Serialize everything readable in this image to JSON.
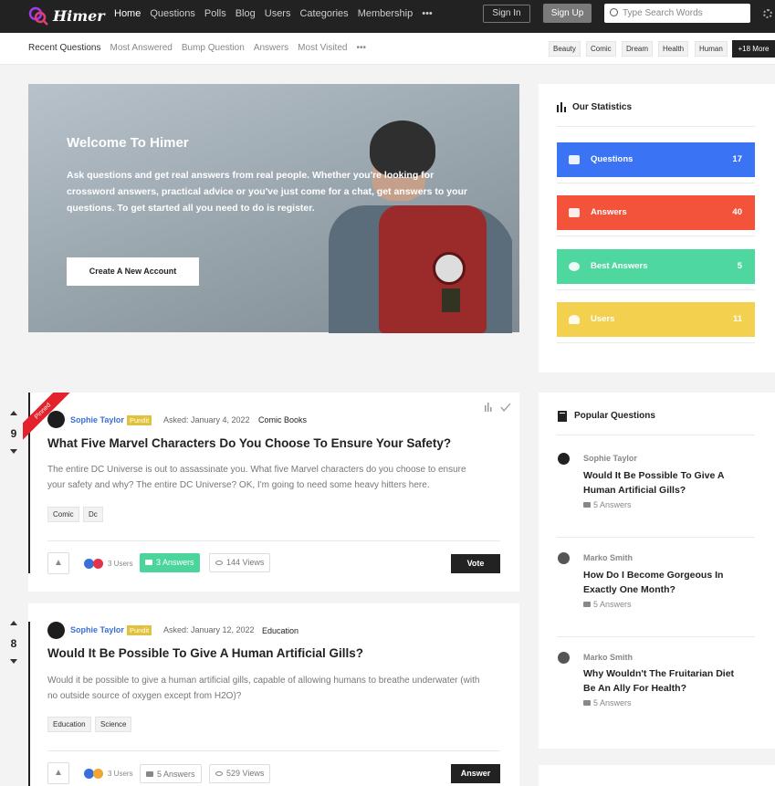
{
  "header": {
    "logo_text": "Himer",
    "nav": [
      "Home",
      "Questions",
      "Polls",
      "Blog",
      "Users",
      "Categories",
      "Membership"
    ],
    "nav_more": "•••",
    "signin": "Sign In",
    "signup": "Sign Up",
    "search_placeholder": "Type Search Words"
  },
  "subnav": {
    "items": [
      "Recent Questions",
      "Most Answered",
      "Bump Question",
      "Answers",
      "Most Visited"
    ],
    "more": "•••",
    "tags": [
      "Beauty",
      "Comic",
      "Dream",
      "Health",
      "Human"
    ],
    "tags_more": "+18 More"
  },
  "hero": {
    "title": "Welcome To Himer",
    "text": "Ask questions and get real answers from real people. Whether you're looking for crossword answers, practical advice or you've just come for a chat, get answers to your questions. To get started all you need to do is register.",
    "button": "Create A New Account"
  },
  "stats": {
    "title": "Our Statistics",
    "items": [
      {
        "label": "Questions",
        "value": "17",
        "color": "#3b73f5"
      },
      {
        "label": "Answers",
        "value": "40",
        "color": "#f2533a"
      },
      {
        "label": "Best Answers",
        "value": "5",
        "color": "#4ed89f"
      },
      {
        "label": "Users",
        "value": "11",
        "color": "#f3d04d"
      }
    ]
  },
  "popular": {
    "title": "Popular Questions",
    "items": [
      {
        "author": "Sophie Taylor",
        "title": "Would It Be Possible To Give A Human Artificial Gills?",
        "answers": "5 Answers"
      },
      {
        "author": "Marko Smith",
        "title": "How Do I Become Gorgeous In Exactly One Month?",
        "answers": "5 Answers"
      },
      {
        "author": "Marko Smith",
        "title": "Why Wouldn't The Fruitarian Diet Be An Ally For Health?",
        "answers": "5 Answers"
      }
    ]
  },
  "questions": [
    {
      "votes": "9",
      "pinned": "Pinned",
      "author": "Sophie Taylor",
      "badge": "Pundit",
      "date": "Asked: January 4, 2022",
      "category": "Comic Books",
      "title": "What Five Marvel Characters Do You Choose To Ensure Your Safety?",
      "excerpt": "The entire DC Universe is out to assassinate you. What five Marvel characters do you choose to ensure your safety and why? The entire DC Universe? OK, I'm going to need some heavy hitters here.",
      "tags": [
        "Comic",
        "Dc"
      ],
      "users": "3 Users",
      "answers": "3 Answers",
      "views": "144  Views",
      "action": "Vote"
    },
    {
      "votes": "8",
      "author": "Sophie Taylor",
      "badge": "Pundit",
      "date": "Asked: January 12, 2022",
      "category": "Education",
      "title": "Would It Be Possible To Give A Human Artificial Gills?",
      "excerpt": "Would it be possible to give a human artificial gills, capable of allowing humans to breathe underwater (with no outside source of oxygen except from H2O)?",
      "tags": [
        "Education",
        "Science"
      ],
      "users": "3 Users",
      "answers": "5 Answers",
      "views": "529  Views",
      "action": "Answer"
    }
  ]
}
